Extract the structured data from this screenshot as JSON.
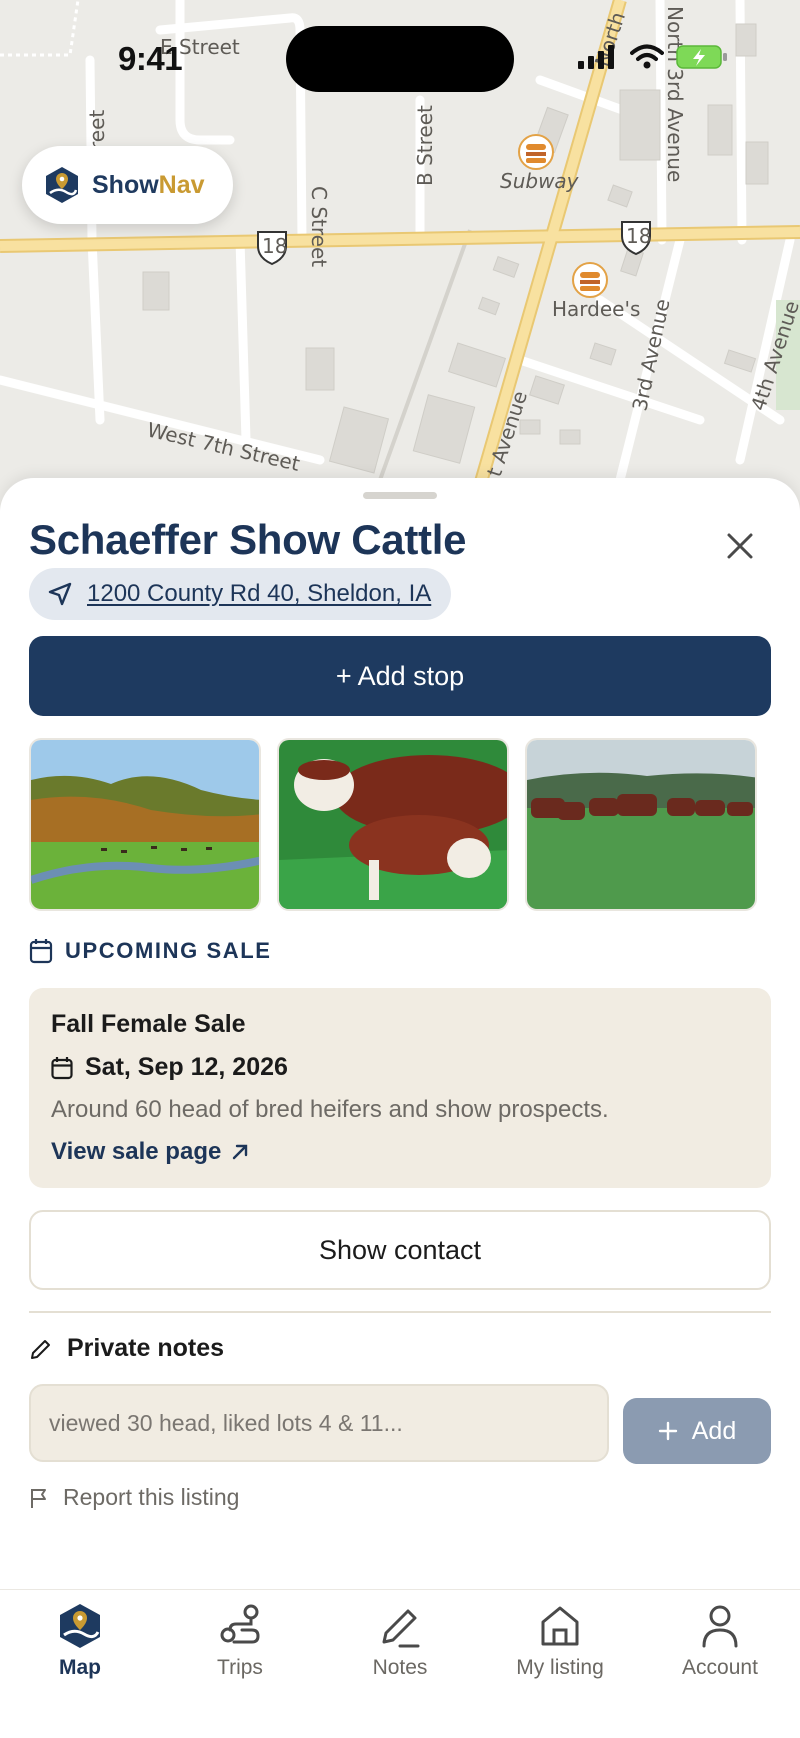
{
  "status_bar": {
    "time": "9:41"
  },
  "brand": {
    "part1": "Show",
    "part2": "Nav"
  },
  "map": {
    "labels": {
      "e_street": "E Street",
      "street_left": "reet",
      "c_street": "C Street",
      "b_street": "B Street",
      "north": "North",
      "north_3rd": "North 3rd Avenue",
      "subway": "Subway",
      "hardees": "Hardee's",
      "route_18_a": "18",
      "route_18_b": "18",
      "third_ave": "3rd Avenue",
      "fourth_ave": "4th Avenue",
      "west_7th": "West 7th Street",
      "avenue": "t Avenue"
    }
  },
  "listing": {
    "title": "Schaeffer Show Cattle",
    "address": "1200 County Rd 40, Sheldon, IA",
    "add_stop_label": "+ Add stop"
  },
  "upcoming_sale": {
    "section_label": "UPCOMING SALE",
    "title": "Fall Female Sale",
    "date": "Sat, Sep 12, 2026",
    "description": "Around 60 head of bred heifers and show prospects.",
    "link_label": "View sale page"
  },
  "contact": {
    "button_label": "Show contact"
  },
  "notes": {
    "header": "Private notes",
    "placeholder": "viewed 30 head, liked lots 4 & 11...",
    "add_label": "Add"
  },
  "report": {
    "label": "Report this listing"
  },
  "tabs": [
    {
      "label": "Map",
      "icon": "map-icon",
      "active": true
    },
    {
      "label": "Trips",
      "icon": "route-icon",
      "active": false
    },
    {
      "label": "Notes",
      "icon": "pencil-icon",
      "active": false
    },
    {
      "label": "My listing",
      "icon": "home-icon",
      "active": false
    },
    {
      "label": "Account",
      "icon": "person-icon",
      "active": false
    }
  ],
  "colors": {
    "navy": "#1e3a60",
    "gold": "#c99a32",
    "sand": "#f1ece2",
    "road_yellow": "#f5d88a"
  }
}
